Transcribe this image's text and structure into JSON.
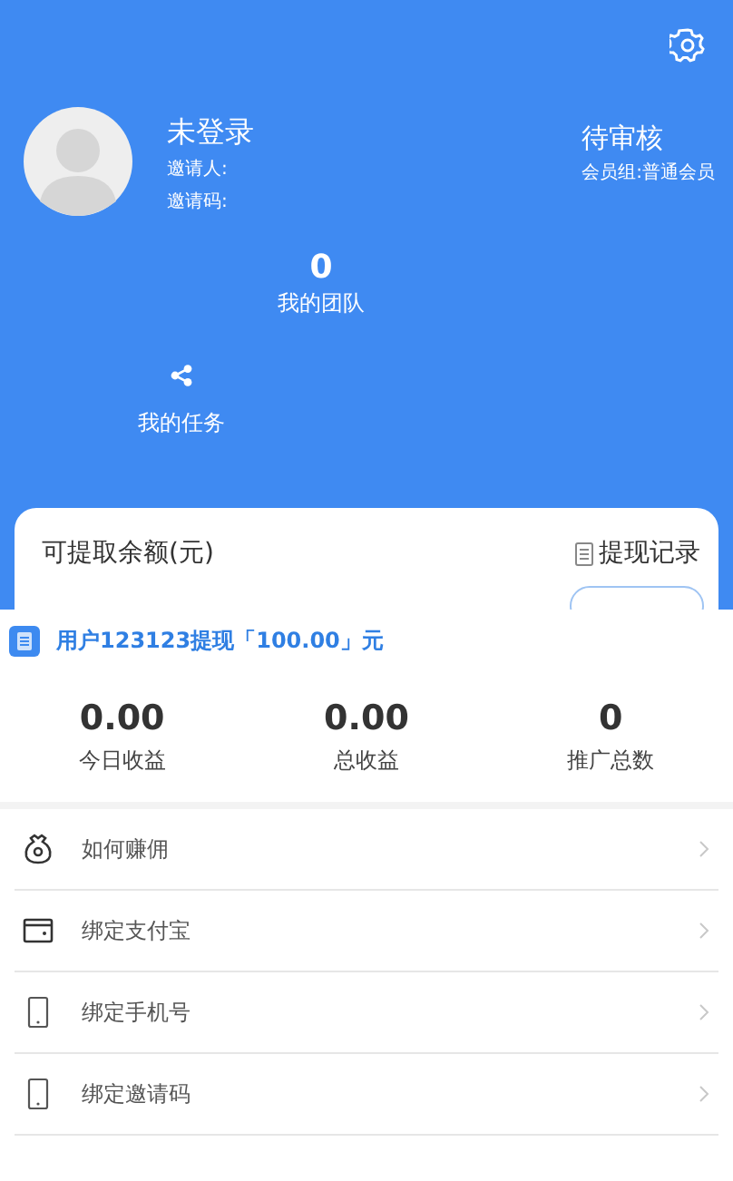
{
  "profile": {
    "name": "未登录",
    "inviter_label": "邀请人:",
    "invite_code_label": "邀请码:",
    "status": "待审核",
    "member_group": "会员组:普通会员"
  },
  "team": {
    "count": "0",
    "label": "我的团队"
  },
  "task": {
    "label": "我的任务"
  },
  "balance_card": {
    "title": "可提取余额(元)",
    "record_link": "提现记录"
  },
  "notice": {
    "text": "用户123123提现「100.00」元"
  },
  "stats": [
    {
      "value": "0.00",
      "label": "今日收益"
    },
    {
      "value": "0.00",
      "label": "总收益"
    },
    {
      "value": "0",
      "label": "推广总数"
    }
  ],
  "menu": [
    {
      "kind": "bag",
      "label": "如何赚佣"
    },
    {
      "kind": "wallet",
      "label": "绑定支付宝"
    },
    {
      "kind": "phone",
      "label": "绑定手机号"
    },
    {
      "kind": "phone",
      "label": "绑定邀请码"
    }
  ]
}
